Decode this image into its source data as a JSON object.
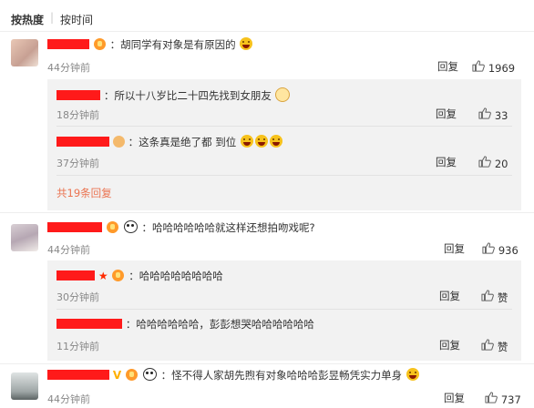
{
  "sort": {
    "hot": "按热度",
    "time": "按时间"
  },
  "comments": [
    {
      "text": "：胡同学有对象是有原因的",
      "time": "44分钟前",
      "reply_label": "回复",
      "likes": "1969",
      "replies": [
        {
          "text": "：所以十八岁比二十四先找到女朋友",
          "time": "18分钟前",
          "reply_label": "回复",
          "likes": "33"
        },
        {
          "text": "：这条真是绝了都   到位",
          "time": "37分钟前",
          "reply_label": "回复",
          "likes": "20"
        }
      ],
      "more_replies": "共19条回复"
    },
    {
      "text": "：哈哈哈哈哈哈就这样还想拍吻戏呢?",
      "time": "44分钟前",
      "reply_label": "回复",
      "likes": "936",
      "replies": [
        {
          "text": "：哈哈哈哈哈哈哈哈",
          "time": "30分钟前",
          "reply_label": "回复",
          "likes": "赞"
        },
        {
          "text": "：哈哈哈哈哈哈，彭彭想哭哈哈哈哈哈哈",
          "time": "11分钟前",
          "reply_label": "回复",
          "likes": "赞"
        }
      ]
    },
    {
      "text": "：怪不得人家胡先煦有对象哈哈哈彭昱畅凭实力单身",
      "time": "44分钟前",
      "reply_label": "回复",
      "likes": "737"
    }
  ],
  "icons": {
    "like": "thumbs-up-icon",
    "laugh": "laughing-emoji-icon",
    "panda": "panda-icon"
  },
  "colors": {
    "link": "#eb7350",
    "redaction": "#ff1a1a",
    "reply_bg": "#f2f2f2"
  }
}
